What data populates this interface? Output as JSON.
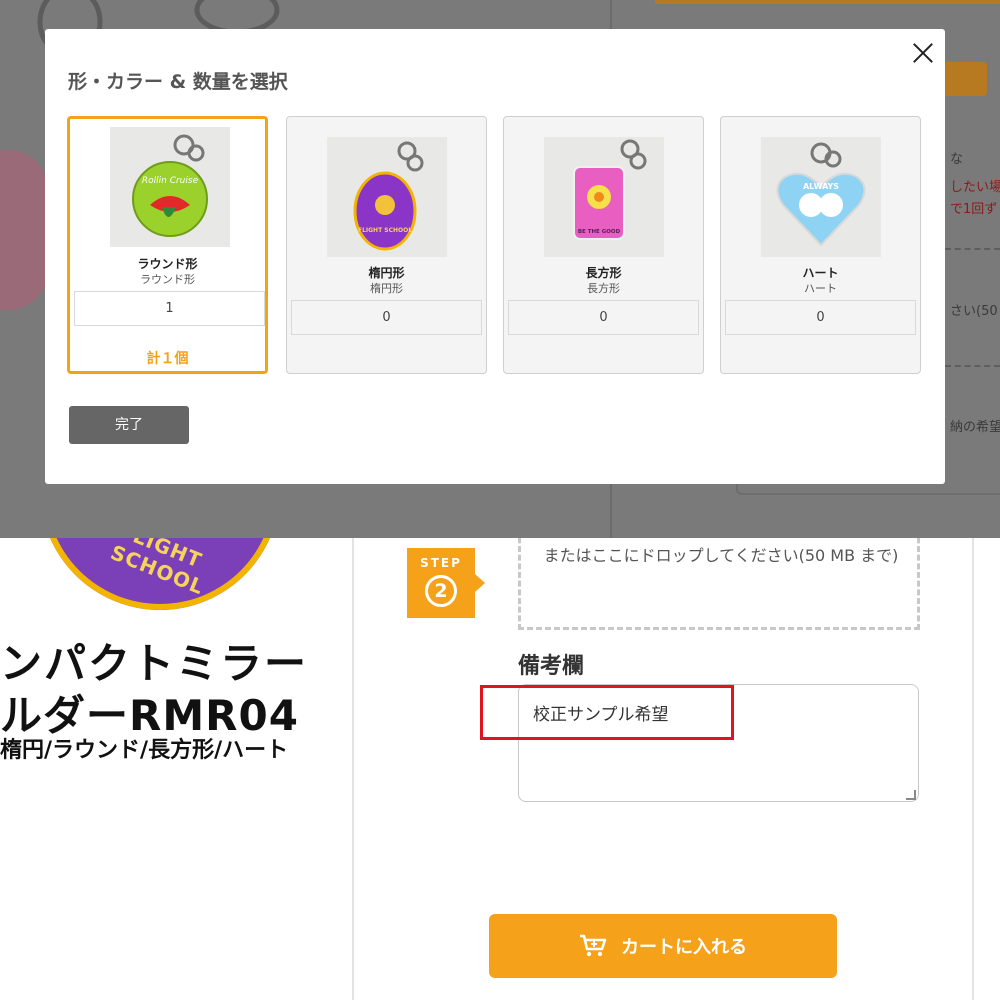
{
  "modal": {
    "title": "形・カラー & 数量を選択",
    "close_label": "×",
    "done_label": "完了",
    "options": [
      {
        "name": "ラウンド形",
        "sub": "ラウンド形",
        "qty": "1",
        "total": "計１個",
        "selected": true
      },
      {
        "name": "楕円形",
        "sub": "楕円形",
        "qty": "0",
        "selected": false
      },
      {
        "name": "長方形",
        "sub": "長方形",
        "qty": "0",
        "selected": false
      },
      {
        "name": "ハート",
        "sub": "ハート",
        "qty": "0",
        "selected": false
      }
    ],
    "option_images": [
      {
        "art_text": "Rollin Cruise",
        "color": "#9ad12b"
      },
      {
        "art_text": "FLIGHT SCHOOL",
        "color": "#8a35c8"
      },
      {
        "art_text": "BE THE GOOD",
        "color": "#e95fc1"
      },
      {
        "art_text": "ALWAYS",
        "color": "#8fd3f4"
      }
    ]
  },
  "background_partial": {
    "right_lines": [
      "な",
      "したい場",
      "で1回ず",
      "さい(50 M",
      "納の希望"
    ]
  },
  "product": {
    "disc_text": "FLIGHT SCHOOL",
    "title_line1": "ンパクトミラー",
    "title_line2": "ルダーRMR04",
    "shapes_line": "楕円/ラウンド/長方形/ハート"
  },
  "order_form": {
    "step_word": "STEP",
    "step_number": "2",
    "dropzone_text": "またはここにドロップしてください(50 MB まで)",
    "notes_label": "備考欄",
    "notes_value": "校正サンプル希望",
    "cart_button_label": "カートに入れる"
  },
  "colors": {
    "accent": "#f5a11a",
    "highlight": "#e0141e",
    "overlay": "#7a7a7a"
  }
}
